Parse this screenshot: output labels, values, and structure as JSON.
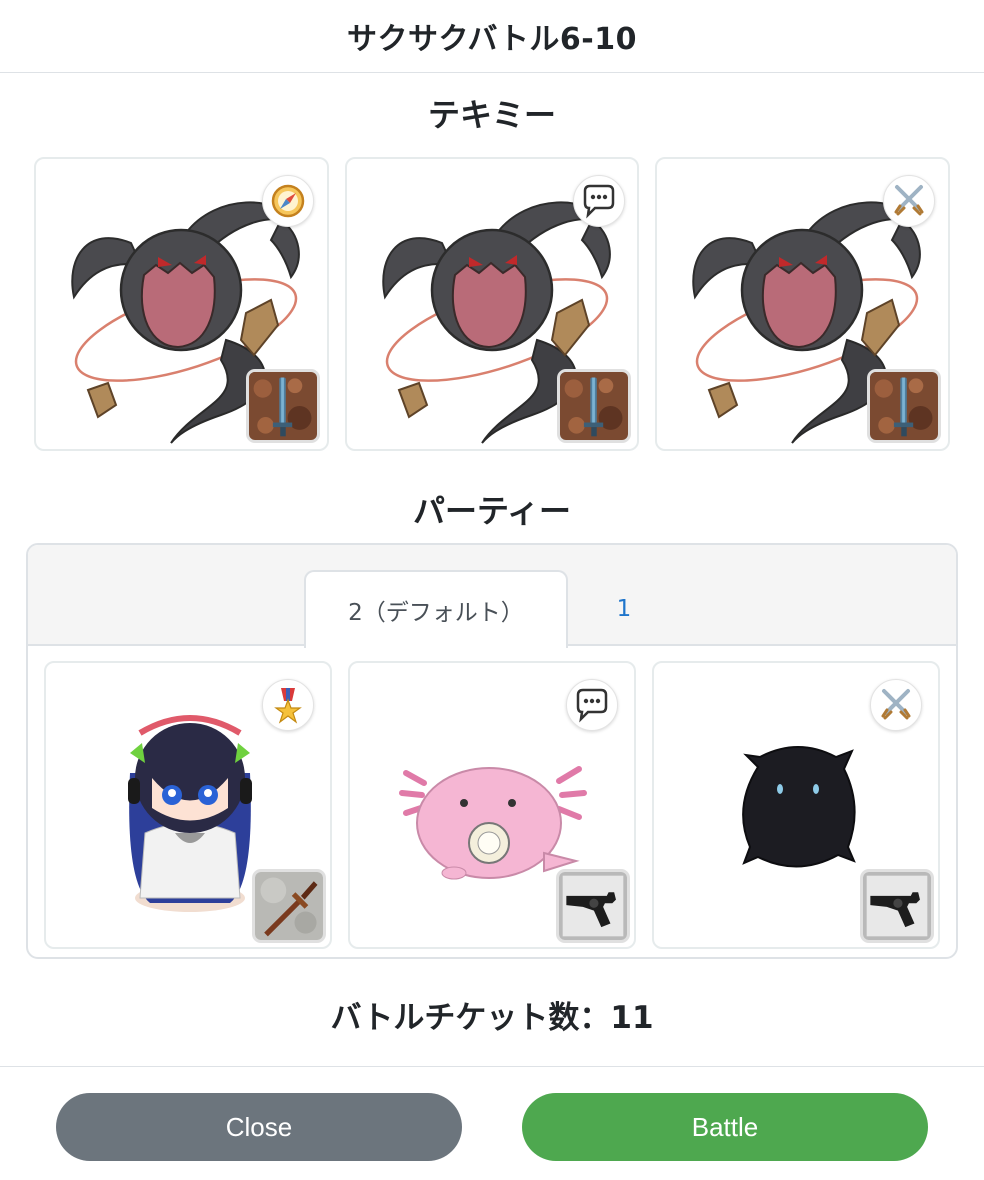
{
  "modal": {
    "title": "サクサクバトル6-10"
  },
  "enemy_section": {
    "title": "テキミー",
    "cards": [
      {
        "name": "ghost-enemy",
        "badge_icon": "compass-icon",
        "weapon_icon": "sword-icon"
      },
      {
        "name": "ghost-enemy",
        "badge_icon": "speech-bubble-icon",
        "weapon_icon": "sword-icon"
      },
      {
        "name": "ghost-enemy",
        "badge_icon": "crossed-swords-icon",
        "weapon_icon": "sword-icon"
      }
    ]
  },
  "party_section": {
    "title": "パーティー",
    "tabs": [
      {
        "label": "2（デフォルト）",
        "active": true
      },
      {
        "label": "1",
        "active": false
      }
    ],
    "cards": [
      {
        "name": "headphone-girl",
        "badge_icon": "medal-icon",
        "weapon_icon": "ornate-sword-icon"
      },
      {
        "name": "pink-axolotl",
        "badge_icon": "speech-bubble-icon",
        "weapon_icon": "revolver-icon"
      },
      {
        "name": "black-slime",
        "badge_icon": "crossed-swords-icon",
        "weapon_icon": "revolver-icon"
      }
    ]
  },
  "tickets": {
    "label": "バトルチケット数：11"
  },
  "buttons": {
    "close": "Close",
    "battle": "Battle"
  },
  "colors": {
    "close": "#6c757d",
    "battle": "#4ea84f",
    "tab_link": "#1f75cb"
  }
}
